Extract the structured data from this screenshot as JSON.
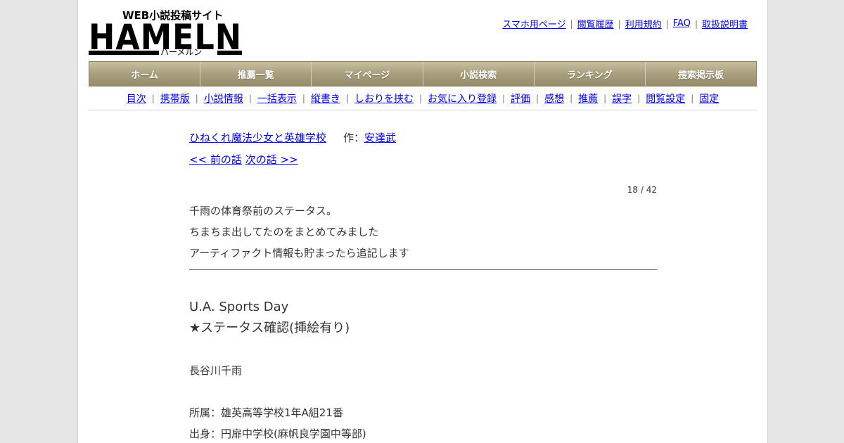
{
  "logo": {
    "main": "HAMELN",
    "tagline": "WEB小説投稿サイト",
    "kana": "ハーメルン"
  },
  "top_links": [
    "スマホ用ページ",
    "閲覧履歴",
    "利用規約",
    "FAQ",
    "取扱説明書"
  ],
  "nav": [
    "ホーム",
    "推薦一覧",
    "マイページ",
    "小説検索",
    "ランキング",
    "捜索掲示板"
  ],
  "subnav": [
    "目次",
    "携帯版",
    "小説情報",
    "一括表示",
    "縦書き",
    "しおりを挟む",
    "お気に入り登録",
    "評価",
    "感想",
    "推薦",
    "誤字",
    "閲覧設定",
    "固定"
  ],
  "novel": {
    "title": "ひねくれ魔法少女と英雄学校",
    "author_label": "作：",
    "author": "安達武",
    "prev": "<< 前の話",
    "next": "次の話 >>",
    "counter": "18 / 42"
  },
  "preface": [
    "千雨の体育祭前のステータス。",
    "ちまちま出してたのをまとめてみました",
    "アーティファクト情報も貯まったら追記します"
  ],
  "body": {
    "heading1": "U.A. Sports Day",
    "heading2": "★ステータス確認(挿絵有り)",
    "name": "長谷川千雨",
    "affiliation": "所属：雄英高等学校1年A組21番",
    "origin": "出身：円扉中学校(麻帆良学園中等部)"
  },
  "colors": {
    "link": "#0000ee",
    "nav_bg": "#a89f7e",
    "page_bg": "#e6e6e6"
  }
}
